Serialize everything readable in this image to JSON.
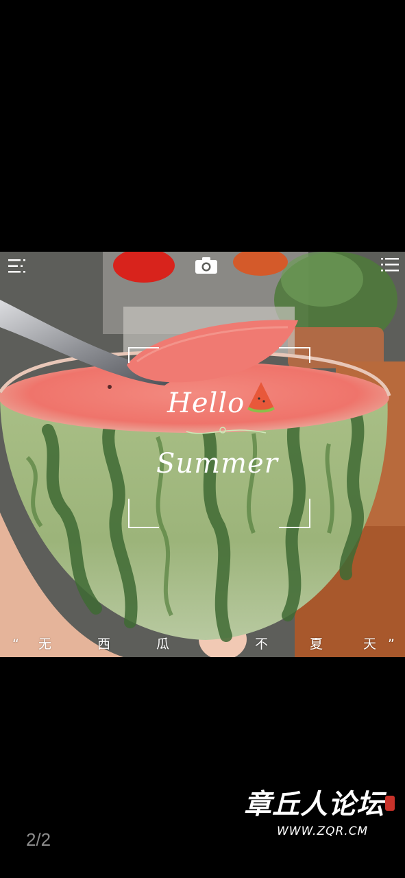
{
  "viewer": {
    "page_indicator": "2/2",
    "watermark": {
      "title": "章丘人论坛",
      "url": "WWW.ZQR.CM"
    }
  },
  "photo": {
    "menu_icon": "menu-icon",
    "camera_icon": "camera-icon",
    "list_icon": "list-icon",
    "hello_text": "Hello",
    "summer_text": "Summer",
    "caption": {
      "open_quote": "“",
      "chars": [
        "无",
        "西",
        "瓜",
        "不",
        "夏",
        "天"
      ],
      "close_quote": "”"
    },
    "colors": {
      "watermelon_flesh": "#f07a72",
      "rind_green": "#8fae6c",
      "stripe_dark": "#3f6a34",
      "flower_red": "#d8231c"
    }
  }
}
